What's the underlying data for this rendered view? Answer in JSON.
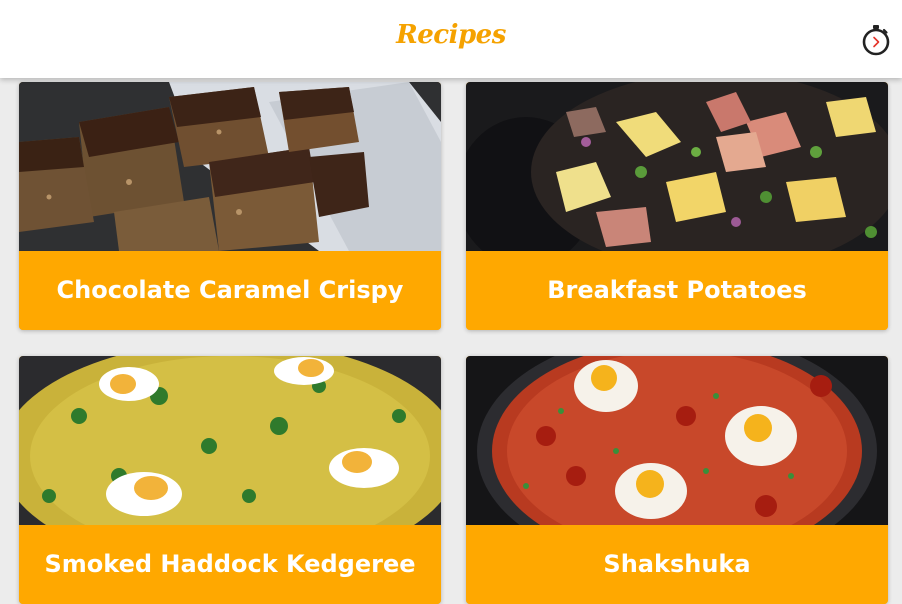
{
  "header": {
    "title": "Recipes",
    "timer_icon": "stopwatch-icon"
  },
  "colors": {
    "accent": "#ffa800",
    "title": "#f5a200",
    "background": "#ececec",
    "app_bar": "#ffffff",
    "card_text": "#ffffff"
  },
  "recipes": [
    {
      "title": "Chocolate Caramel Crispy"
    },
    {
      "title": "Breakfast Potatoes"
    },
    {
      "title": "Smoked Haddock Kedgeree"
    },
    {
      "title": "Shakshuka"
    }
  ]
}
